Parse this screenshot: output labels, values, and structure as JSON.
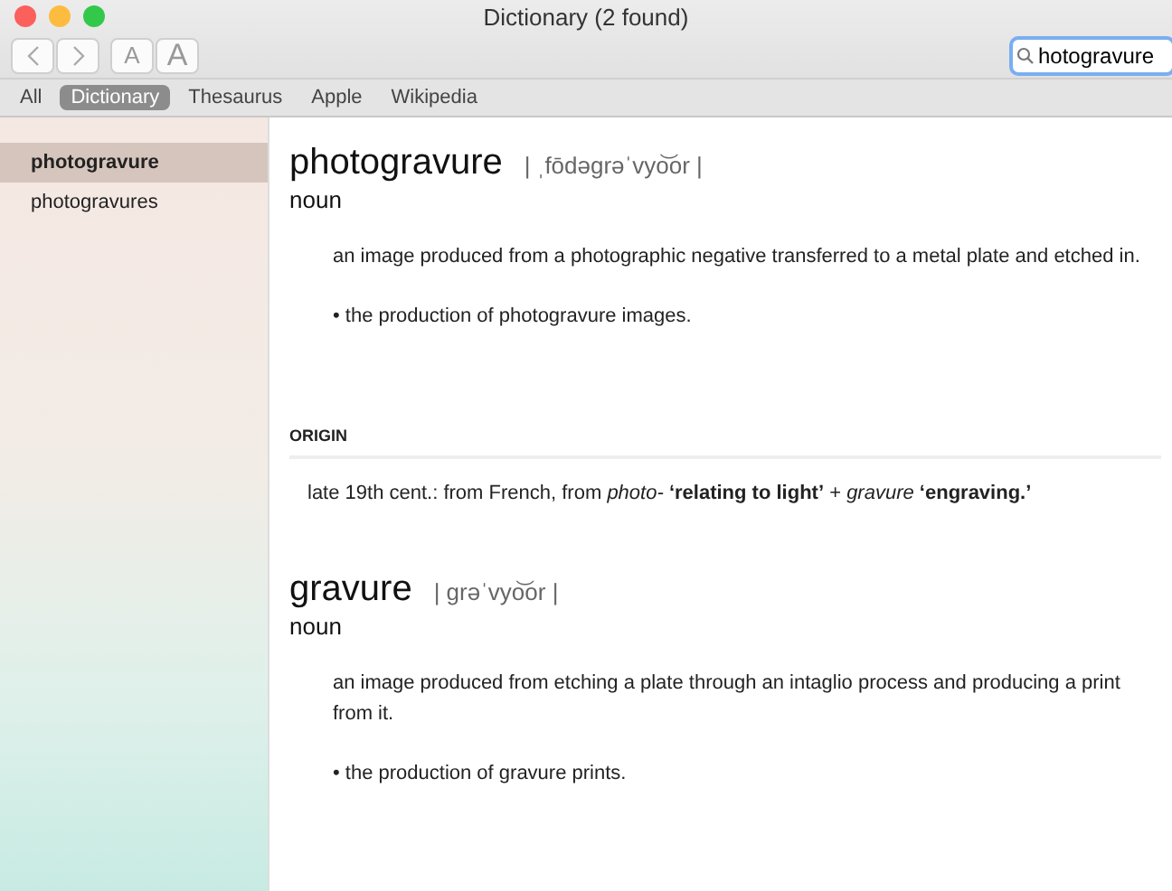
{
  "window": {
    "title": "Dictionary (2 found)"
  },
  "toolbar": {
    "font_buttons": [
      "A",
      "A"
    ],
    "search": {
      "value": "hotogravure"
    }
  },
  "sources": [
    {
      "label": "All",
      "selected": false
    },
    {
      "label": "Dictionary",
      "selected": true
    },
    {
      "label": "Thesaurus",
      "selected": false
    },
    {
      "label": "Apple",
      "selected": false
    },
    {
      "label": "Wikipedia",
      "selected": false
    }
  ],
  "sidebar": {
    "items": [
      {
        "label": "photogravure",
        "selected": true
      },
      {
        "label": "photogravures",
        "selected": false
      }
    ]
  },
  "entries": [
    {
      "headword": "photogravure",
      "pronunciation": "| ˌfōdəgrəˈvyo͝or |",
      "part_of_speech": "noun",
      "definitions": [
        "an image produced from a photographic negative transferred to a metal plate and etched in.",
        "• the production of photogravure images."
      ],
      "origin": {
        "heading": "ORIGIN",
        "text": "late 19th cent.: from French, from *photo-* **‘relating to light’** + *gravure* **‘engraving.’**"
      }
    },
    {
      "headword": "gravure",
      "pronunciation": "| grəˈvyo͝or |",
      "part_of_speech": "noun",
      "definitions": [
        "an image produced from etching a plate through an intaglio process and producing a print from it.",
        "• the production of gravure prints."
      ]
    }
  ]
}
